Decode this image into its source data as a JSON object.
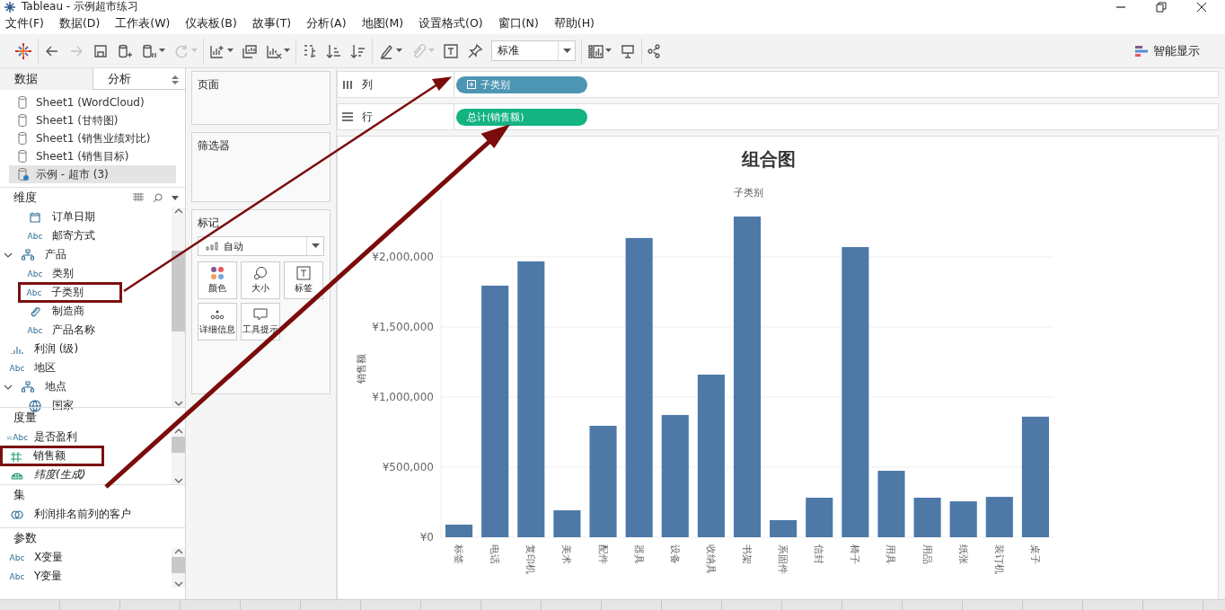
{
  "window": {
    "title": "Tableau - 示例超市练习"
  },
  "menu": [
    "文件(F)",
    "数据(D)",
    "工作表(W)",
    "仪表板(B)",
    "故事(T)",
    "分析(A)",
    "地图(M)",
    "设置格式(O)",
    "窗口(N)",
    "帮助(H)"
  ],
  "toolbar": {
    "groups": [
      [
        {
          "kind": "logo"
        }
      ],
      [
        {
          "kind": "undo",
          "disabled": false,
          "caret": false
        },
        {
          "kind": "redo",
          "disabled": true,
          "caret": false
        },
        {
          "kind": "save",
          "disabled": false,
          "caret": false
        },
        {
          "kind": "new-datasource",
          "disabled": false,
          "caret": false
        },
        {
          "kind": "pause",
          "disabled": false,
          "caret": true
        },
        {
          "kind": "refresh",
          "disabled": true,
          "caret": true
        }
      ],
      [
        {
          "kind": "new-sheet",
          "disabled": false,
          "caret": true
        },
        {
          "kind": "duplicate",
          "disabled": false,
          "caret": false
        },
        {
          "kind": "clear",
          "disabled": false,
          "caret": true
        }
      ],
      [
        {
          "kind": "swap",
          "disabled": false,
          "caret": false
        },
        {
          "kind": "sort-asc",
          "disabled": false,
          "caret": false
        },
        {
          "kind": "sort-desc",
          "disabled": false,
          "caret": false
        }
      ],
      [
        {
          "kind": "highlight",
          "disabled": false,
          "caret": true
        },
        {
          "kind": "attach",
          "disabled": true,
          "caret": true
        },
        {
          "kind": "text",
          "disabled": false,
          "caret": false
        },
        {
          "kind": "pin",
          "disabled": false,
          "caret": false
        },
        {
          "kind": "dropdown",
          "value": "标准"
        }
      ],
      [
        {
          "kind": "show-cards",
          "disabled": false,
          "caret": true
        },
        {
          "kind": "presentation",
          "disabled": false,
          "caret": false
        }
      ],
      [
        {
          "kind": "share",
          "disabled": false,
          "caret": false
        }
      ]
    ],
    "show_me": "智能显示"
  },
  "data_pane": {
    "tabs": [
      {
        "label": "数据",
        "selected": true
      },
      {
        "label": "分析",
        "selected": false
      }
    ],
    "data_sources": [
      {
        "name": "Sheet1 (WordCloud)",
        "selected": false,
        "live": false
      },
      {
        "name": "Sheet1 (甘特图)",
        "selected": false,
        "live": false
      },
      {
        "name": "Sheet1 (销售业绩对比)",
        "selected": false,
        "live": false
      },
      {
        "name": "Sheet1 (销售目标)",
        "selected": false,
        "live": false
      },
      {
        "name": "示例 - 超市 (3)",
        "selected": true,
        "live": true
      }
    ],
    "dimensions": {
      "title": "维度",
      "fields": [
        {
          "kind": "continued",
          "children": [
            {
              "kind": "date",
              "name": "订单日期",
              "annotated": false
            },
            {
              "badge": "Abc",
              "name": "邮寄方式",
              "annotated": false
            }
          ]
        },
        {
          "kind": "hierarchy",
          "name": "产品",
          "expanded": true,
          "children": [
            {
              "badge": "Abc",
              "name": "类别",
              "annotated": false
            },
            {
              "badge": "Abc",
              "name": "子类别",
              "annotated": true
            },
            {
              "kind": "group",
              "name": "制造商",
              "annotated": false
            },
            {
              "badge": "Abc",
              "name": "产品名称",
              "annotated": false
            }
          ]
        },
        {
          "kind": "bin",
          "name": "利润 (级)",
          "annotated": false
        },
        {
          "badge": "Abc",
          "name": "地区",
          "annotated": false
        },
        {
          "kind": "hierarchy",
          "name": "地点",
          "expanded": true,
          "children": [
            {
              "kind": "geo",
              "name": "国家",
              "annotated": false
            }
          ]
        }
      ]
    },
    "measures": {
      "title": "度量",
      "fields": [
        {
          "badge": "=Abc",
          "name": "是否盈利",
          "annotated": false
        },
        {
          "kind": "number",
          "name": "销售额",
          "annotated": true
        },
        {
          "kind": "geo_measure",
          "name": "纬度(生成)",
          "annotated": false
        }
      ]
    },
    "sets": {
      "title": "集",
      "fields": [
        {
          "kind": "set",
          "name": "利润排名前列的客户"
        }
      ]
    },
    "parameters": {
      "title": "参数",
      "fields": [
        {
          "badge": "Abc",
          "name": "X变量"
        },
        {
          "badge": "Abc",
          "name": "Y变量"
        }
      ]
    }
  },
  "pages_card": {
    "title": "页面"
  },
  "filters_card": {
    "title": "筛选器"
  },
  "marks_card": {
    "title": "标记",
    "mark_type": "自动",
    "buttons": [
      {
        "kind": "color",
        "label": "颜色"
      },
      {
        "kind": "size",
        "label": "大小"
      },
      {
        "kind": "label",
        "label": "标签"
      },
      {
        "kind": "detail",
        "label": "详细信息"
      },
      {
        "kind": "tooltip",
        "label": "工具提示"
      }
    ]
  },
  "shelves": [
    {
      "kind": "columns",
      "label": "列",
      "pill": {
        "label": "子类别",
        "color": "#4c96b3",
        "expandable": true
      }
    },
    {
      "kind": "rows",
      "label": "行",
      "pill": {
        "label": "总计(销售额)",
        "color": "#13b382",
        "expandable": false
      }
    }
  ],
  "view": {
    "chart_data": {
      "type": "bar",
      "title": "组合图",
      "xlabel": "子类别",
      "ylabel": "销售额",
      "grid": true,
      "categories": [
        "标签",
        "电话",
        "复印机",
        "美术",
        "配件",
        "器具",
        "设备",
        "收纳具",
        "书架",
        "系固件",
        "信封",
        "椅子",
        "用具",
        "用品",
        "纸张",
        "装订机",
        "桌子"
      ],
      "series": [
        {
          "color": "#4e79a7",
          "values": [
            90000,
            1795000,
            1968000,
            192000,
            795000,
            2135000,
            872000,
            1160000,
            2288000,
            122000,
            282000,
            2070000,
            474000,
            282000,
            256000,
            288000,
            860000
          ]
        }
      ],
      "ylim": [
        0,
        2410000
      ],
      "yticks": [
        {
          "value": 0,
          "label": "¥0"
        },
        {
          "value": 500000,
          "label": "¥500,000"
        },
        {
          "value": 1000000,
          "label": "¥1,000,000"
        },
        {
          "value": 1500000,
          "label": "¥1,500,000"
        },
        {
          "value": 2000000,
          "label": "¥2,000,000"
        }
      ]
    }
  }
}
